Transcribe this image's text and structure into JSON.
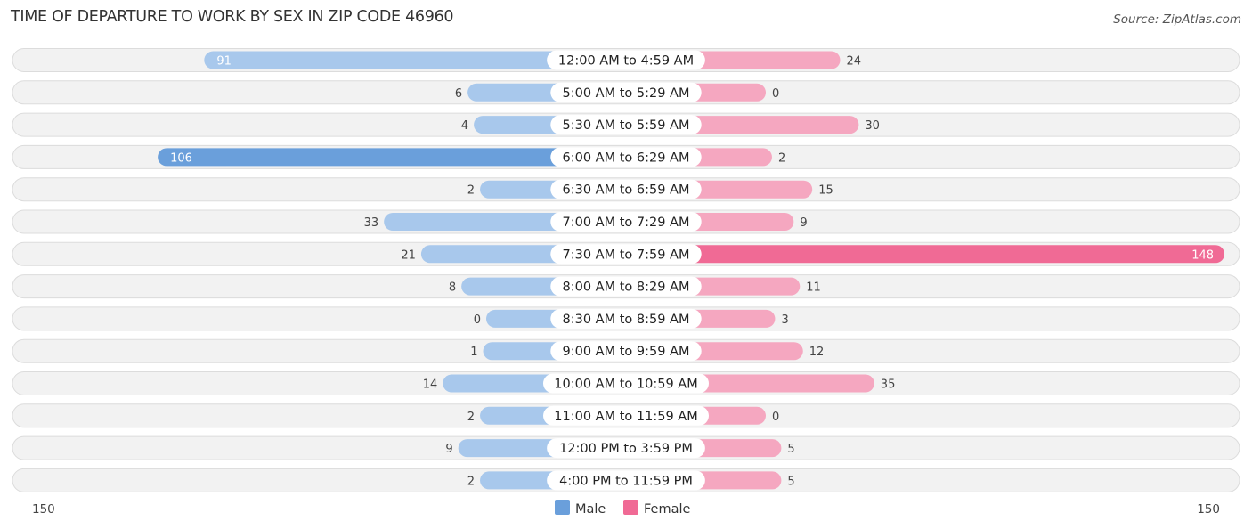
{
  "header": {
    "title": "TIME OF DEPARTURE TO WORK BY SEX IN ZIP CODE 46960",
    "source": "Source: ZipAtlas.com"
  },
  "chart_data": {
    "type": "bar",
    "orientation": "horizontal-diverging",
    "title": "TIME OF DEPARTURE TO WORK BY SEX IN ZIP CODE 46960",
    "categories": [
      "12:00 AM to 4:59 AM",
      "5:00 AM to 5:29 AM",
      "5:30 AM to 5:59 AM",
      "6:00 AM to 6:29 AM",
      "6:30 AM to 6:59 AM",
      "7:00 AM to 7:29 AM",
      "7:30 AM to 7:59 AM",
      "8:00 AM to 8:29 AM",
      "8:30 AM to 8:59 AM",
      "9:00 AM to 9:59 AM",
      "10:00 AM to 10:59 AM",
      "11:00 AM to 11:59 AM",
      "12:00 PM to 3:59 PM",
      "4:00 PM to 11:59 PM"
    ],
    "series": [
      {
        "name": "Male",
        "color": "#6a9fdb",
        "light_color": "#a8c8ec",
        "values": [
          91,
          6,
          4,
          106,
          2,
          33,
          21,
          8,
          0,
          1,
          14,
          2,
          9,
          2
        ]
      },
      {
        "name": "Female",
        "color": "#f06a95",
        "light_color": "#f5a7c0",
        "values": [
          24,
          0,
          30,
          2,
          15,
          9,
          148,
          11,
          3,
          12,
          35,
          0,
          5,
          5
        ]
      }
    ],
    "axis": {
      "left_label": "150",
      "right_label": "150",
      "max": 150
    },
    "legend": {
      "position": "bottom-center",
      "items": [
        "Male",
        "Female"
      ]
    }
  }
}
